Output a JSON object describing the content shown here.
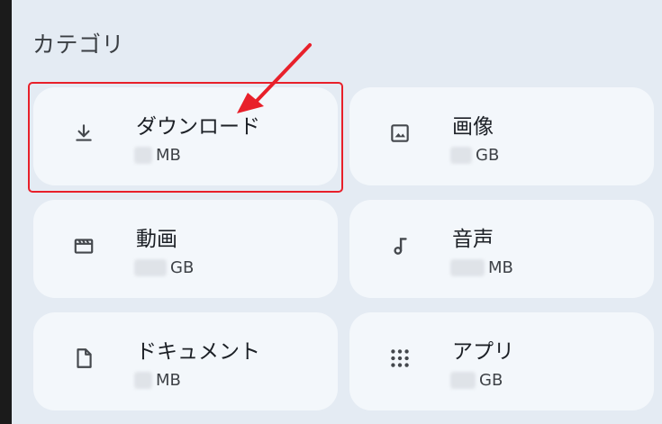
{
  "section": {
    "title": "カテゴリ"
  },
  "categories": [
    {
      "id": "download",
      "label": "ダウンロード",
      "unit": "MB",
      "icon": "download-icon"
    },
    {
      "id": "images",
      "label": "画像",
      "unit": "GB",
      "icon": "image-icon"
    },
    {
      "id": "videos",
      "label": "動画",
      "unit": "GB",
      "icon": "movie-icon"
    },
    {
      "id": "audio",
      "label": "音声",
      "unit": "MB",
      "icon": "music-note-icon"
    },
    {
      "id": "documents",
      "label": "ドキュメント",
      "unit": "MB",
      "icon": "document-icon"
    },
    {
      "id": "apps",
      "label": "アプリ",
      "unit": "GB",
      "icon": "apps-grid-icon"
    }
  ],
  "annotation": {
    "highlight_color": "#e8202a",
    "arrow_color": "#e8202a"
  }
}
